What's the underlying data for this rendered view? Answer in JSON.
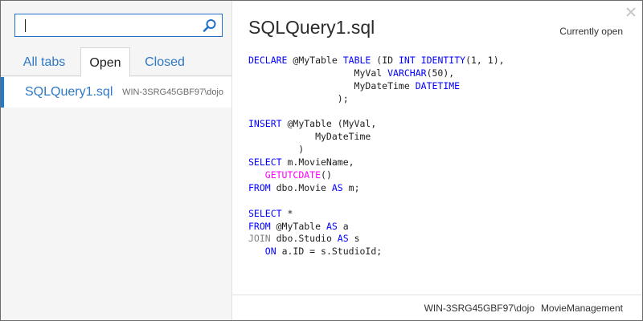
{
  "search": {
    "value": "",
    "placeholder": ""
  },
  "tabs": [
    {
      "label": "All tabs"
    },
    {
      "label": "Open"
    },
    {
      "label": "Closed"
    }
  ],
  "list": [
    {
      "name": "SQLQuery1.sql",
      "server": "WIN-3SRG45GBF97\\dojo"
    }
  ],
  "document": {
    "title": "SQLQuery1.sql",
    "status": "Currently open",
    "code_lines": [
      [
        [
          "kw",
          "DECLARE"
        ],
        [
          "t",
          " @MyTable "
        ],
        [
          "kw",
          "TABLE"
        ],
        [
          "t",
          " (ID "
        ],
        [
          "kw",
          "INT"
        ],
        [
          "t",
          " "
        ],
        [
          "kw",
          "IDENTITY"
        ],
        [
          "t",
          "(1, 1),"
        ]
      ],
      [
        [
          "t",
          "                   MyVal "
        ],
        [
          "kw",
          "VARCHAR"
        ],
        [
          "t",
          "(50),"
        ]
      ],
      [
        [
          "t",
          "                   MyDateTime "
        ],
        [
          "kw",
          "DATETIME"
        ]
      ],
      [
        [
          "t",
          "                );"
        ]
      ],
      [],
      [
        [
          "kw",
          "INSERT"
        ],
        [
          "t",
          " @MyTable (MyVal,"
        ]
      ],
      [
        [
          "t",
          "            MyDateTime"
        ]
      ],
      [
        [
          "t",
          "         )"
        ]
      ],
      [
        [
          "kw",
          "SELECT"
        ],
        [
          "t",
          " m.MovieName,"
        ]
      ],
      [
        [
          "t",
          "   "
        ],
        [
          "fn",
          "GETUTCDATE"
        ],
        [
          "t",
          "()"
        ]
      ],
      [
        [
          "kw",
          "FROM"
        ],
        [
          "t",
          " dbo.Movie "
        ],
        [
          "kw",
          "AS"
        ],
        [
          "t",
          " m;"
        ]
      ],
      [],
      [
        [
          "kw",
          "SELECT"
        ],
        [
          "t",
          " *"
        ]
      ],
      [
        [
          "kw",
          "FROM"
        ],
        [
          "t",
          " @MyTable "
        ],
        [
          "kw",
          "AS"
        ],
        [
          "t",
          " a"
        ]
      ],
      [
        [
          "gr",
          "JOIN"
        ],
        [
          "t",
          " dbo.Studio "
        ],
        [
          "kw",
          "AS"
        ],
        [
          "t",
          " s"
        ]
      ],
      [
        [
          "t",
          "   "
        ],
        [
          "kw",
          "ON"
        ],
        [
          "t",
          " a.ID = s.StudioId;"
        ]
      ]
    ]
  },
  "footer": {
    "server": "WIN-3SRG45GBF97\\dojo",
    "database": "MovieManagement"
  },
  "colors": {
    "accent": "#2e78c6",
    "keyword": "#0000ff",
    "function": "#ff00ff",
    "join": "#808080"
  },
  "icons": {
    "search": "search-icon",
    "close": "close-icon"
  }
}
